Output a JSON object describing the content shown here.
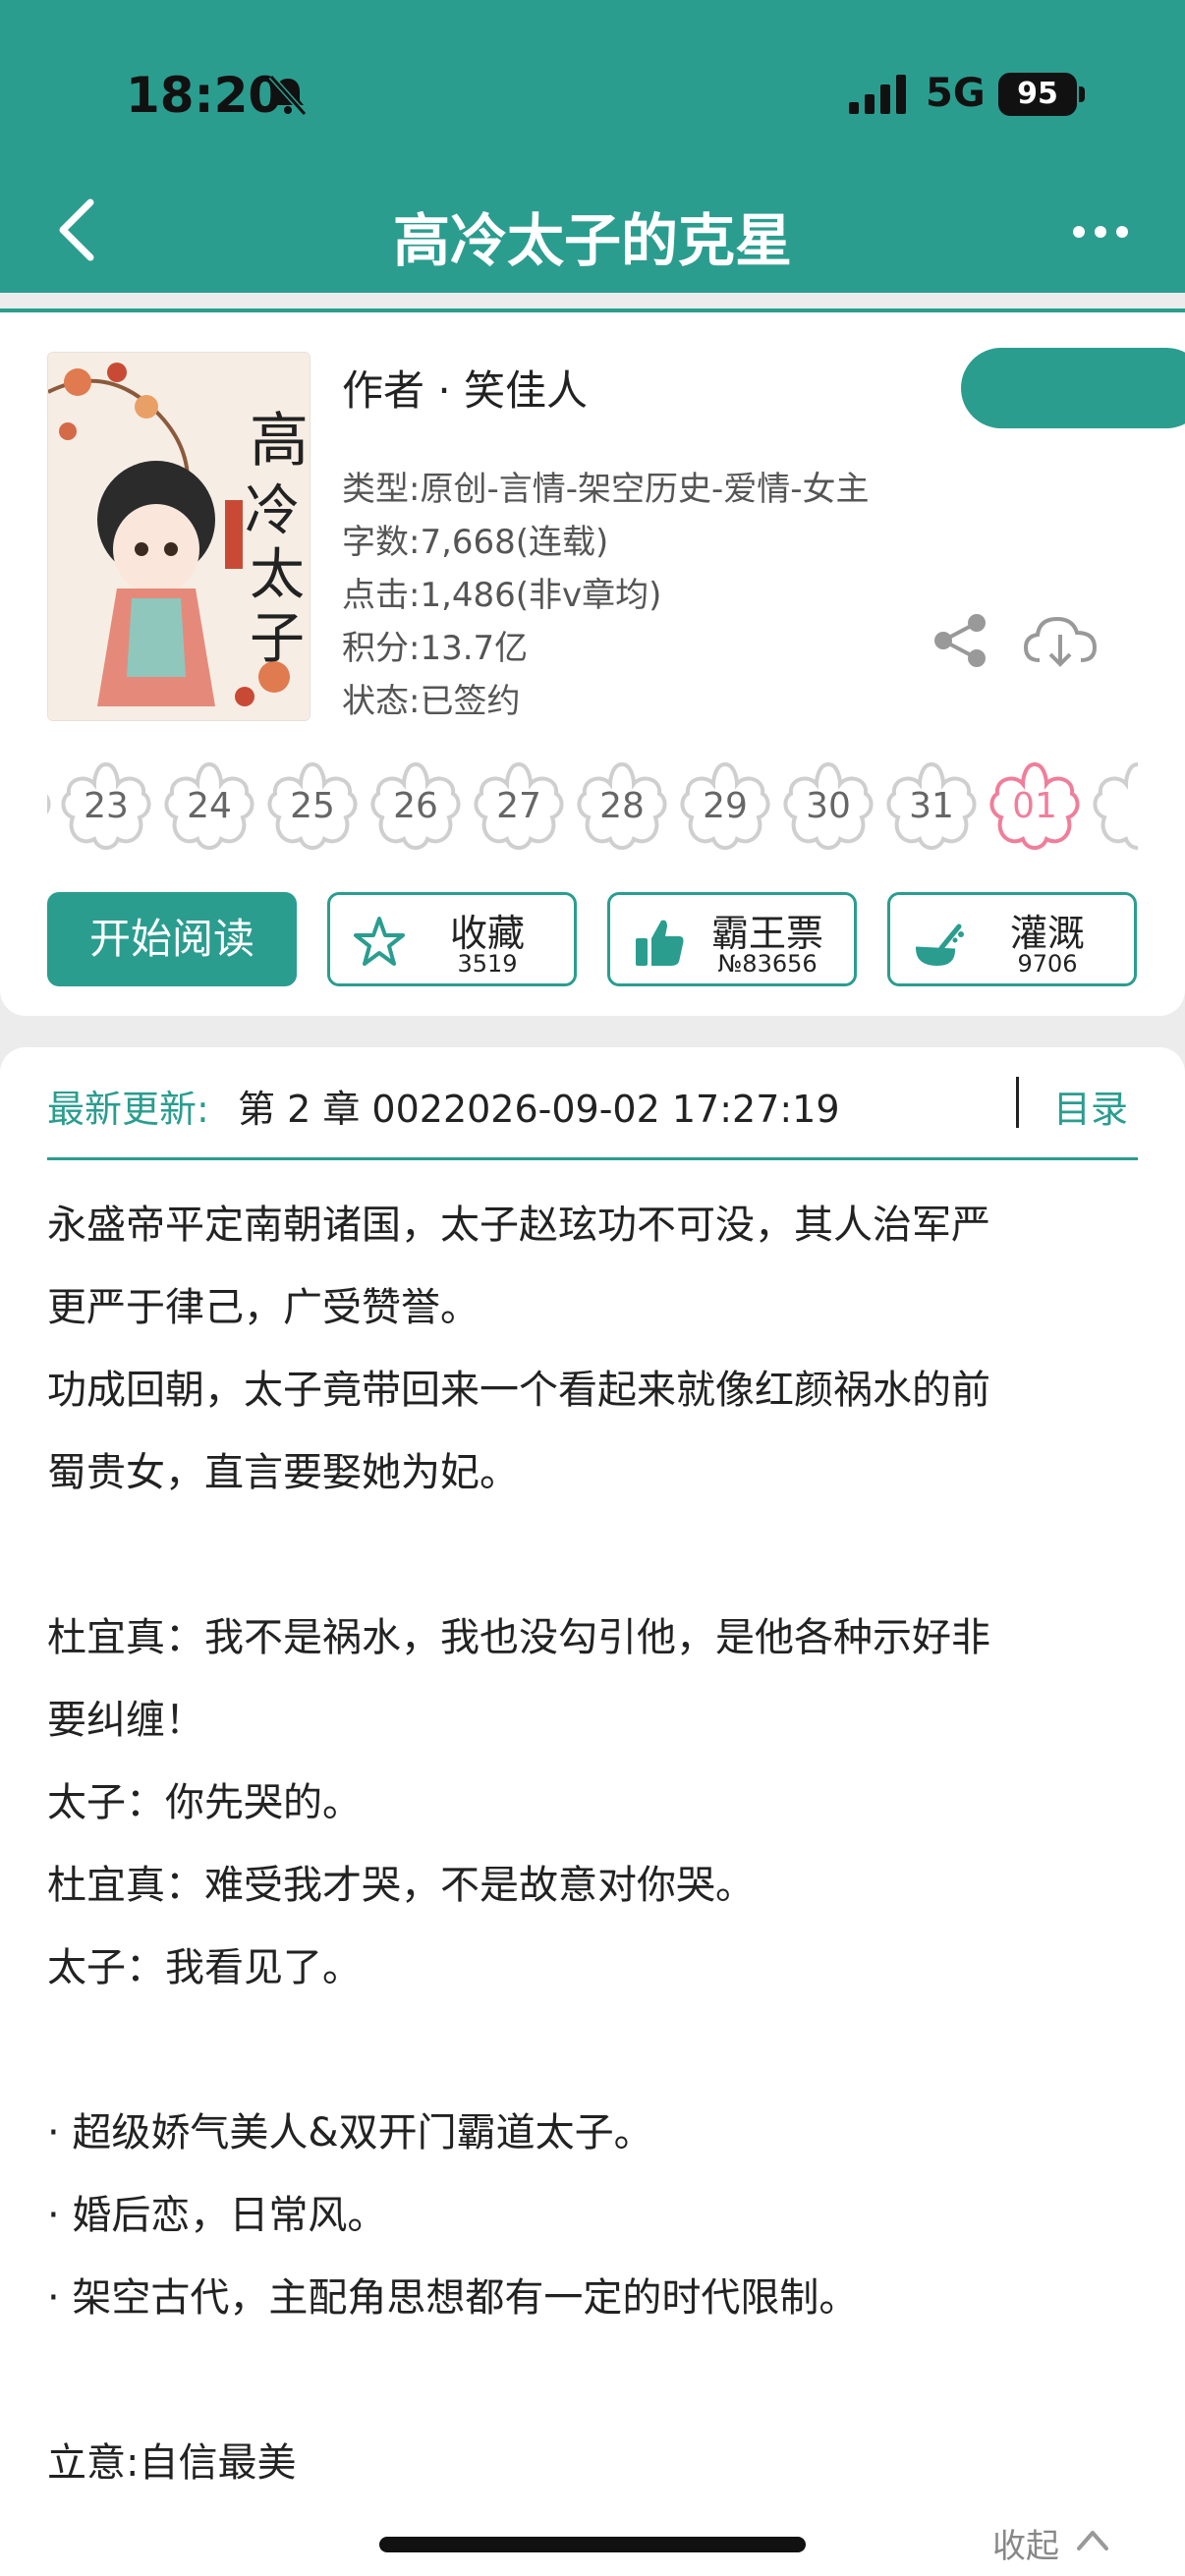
{
  "status": {
    "time": "18:20",
    "network": "5G",
    "battery": "95"
  },
  "nav": {
    "title": "高冷太子的克星"
  },
  "book": {
    "author_line": "作者 · 笑佳人",
    "type": "类型:原创-言情-架空历史-爱情-女主",
    "words": "字数:7,668(连载)",
    "clicks": "点击:1,486(非v章均)",
    "points": "积分:13.7亿",
    "state": "状态:已签约"
  },
  "calendar": {
    "days": [
      "23",
      "24",
      "25",
      "26",
      "27",
      "28",
      "29",
      "30",
      "31",
      "01"
    ],
    "active": "01"
  },
  "actions": {
    "read_label": "开始阅读",
    "collect_label": "收藏",
    "collect_count": "3519",
    "ticket_label": "霸王票",
    "ticket_count": "№83656",
    "water_label": "灌溉",
    "water_count": "9706"
  },
  "update": {
    "label": "最新更新:",
    "text": "第 2 章 0022026-09-02 17:27:19",
    "toc": "目录"
  },
  "synopsis": [
    "永盛帝平定南朝诸国，太子赵玹功不可没，其人治军严",
    "更严于律己，广受赞誉。",
    "功成回朝，太子竟带回来一个看起来就像红颜祸水的前",
    "蜀贵女，直言要娶她为妃。",
    "杜宜真：我不是祸水，我也没勾引他，是他各种示好非",
    "要纠缠！",
    "太子：你先哭的。",
    "杜宜真：难受我才哭，不是故意对你哭。",
    "太子：我看见了。",
    "· 超级娇气美人&双开门霸道太子。",
    "· 婚后恋，日常风。",
    "· 架空古代，主配角思想都有一定的时代限制。",
    "立意:自信最美"
  ],
  "footer": {
    "collapse": "收起"
  },
  "colors": {
    "accent": "#2a9d8f",
    "active_day": "#f07e9b"
  }
}
